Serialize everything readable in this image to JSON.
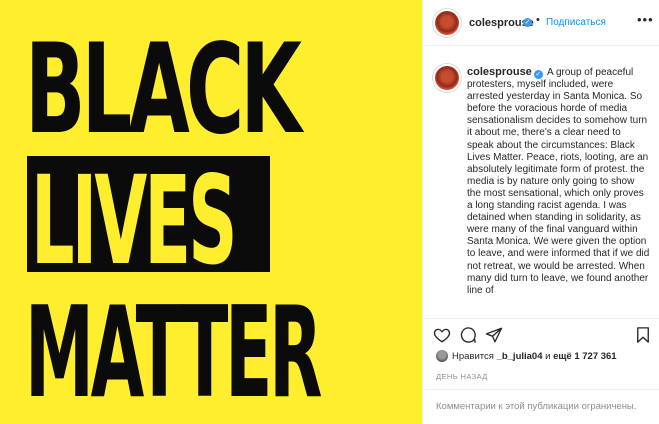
{
  "image": {
    "word1": "BLACK",
    "word2": "LIVES",
    "word3": "MATTER",
    "background_color": "#ffee2d",
    "text_color": "#0b0b0b"
  },
  "header": {
    "username": "colesprouse",
    "separator": "•",
    "follow_label": "Подписаться",
    "more_icon": "more-horizontal-icon"
  },
  "caption": {
    "username": "colesprouse",
    "text": "A group of peaceful protesters, myself included, were arrested yesterday in Santa Monica. So before the voracious horde of media sensationalism decides to somehow turn it about me, there's a clear need to speak about the circumstances: Black Lives Matter. Peace, riots, looting, are an absolutely legitimate form of protest. the media is by nature only going to show the most sensational, which only proves a long standing racist agenda. I was detained when standing in solidarity, as were many of the final vanguard within Santa Monica. We were given the option to leave, and were informed that if we did not retreat, we would be arrested. When many did turn to leave, we found another line of"
  },
  "actions": {
    "icons": [
      "heart-icon",
      "comment-icon",
      "share-icon",
      "bookmark-icon"
    ]
  },
  "likes": {
    "prefix": "Нравится",
    "user": "_b_julia04",
    "conjunction": "и",
    "more": "ещё 1 727 361"
  },
  "time_ago": "ДЕНЬ НАЗАД",
  "comments_disabled": "Комментарии к этой публикации ограничены.",
  "colors": {
    "link": "#0095f6",
    "verified": "#3897f0",
    "muted": "#8e8e8e"
  }
}
